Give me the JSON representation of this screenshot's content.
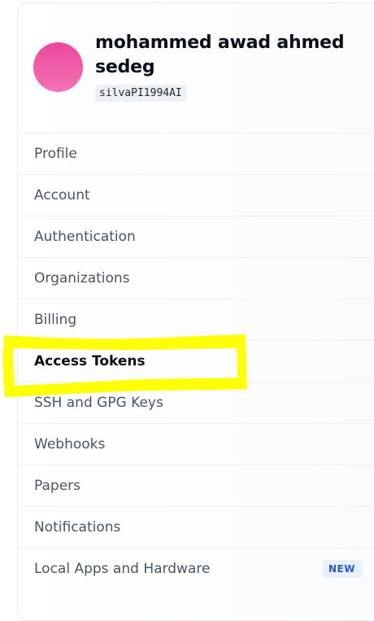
{
  "user": {
    "display_name": "mohammed awad ahmed sedeg",
    "username": "silvaPI1994AI"
  },
  "nav": {
    "items": [
      {
        "label": "Profile"
      },
      {
        "label": "Account"
      },
      {
        "label": "Authentication"
      },
      {
        "label": "Organizations"
      },
      {
        "label": "Billing"
      },
      {
        "label": "Access Tokens",
        "active": true
      },
      {
        "label": "SSH and GPG Keys"
      },
      {
        "label": "Webhooks"
      },
      {
        "label": "Papers"
      },
      {
        "label": "Notifications"
      },
      {
        "label": "Local Apps and Hardware",
        "badge": "NEW"
      }
    ]
  },
  "colors": {
    "avatar": "#ec4899",
    "highlight": "#ffff00",
    "badge_text": "#2a55d4",
    "badge_bg": "#e8efff"
  }
}
